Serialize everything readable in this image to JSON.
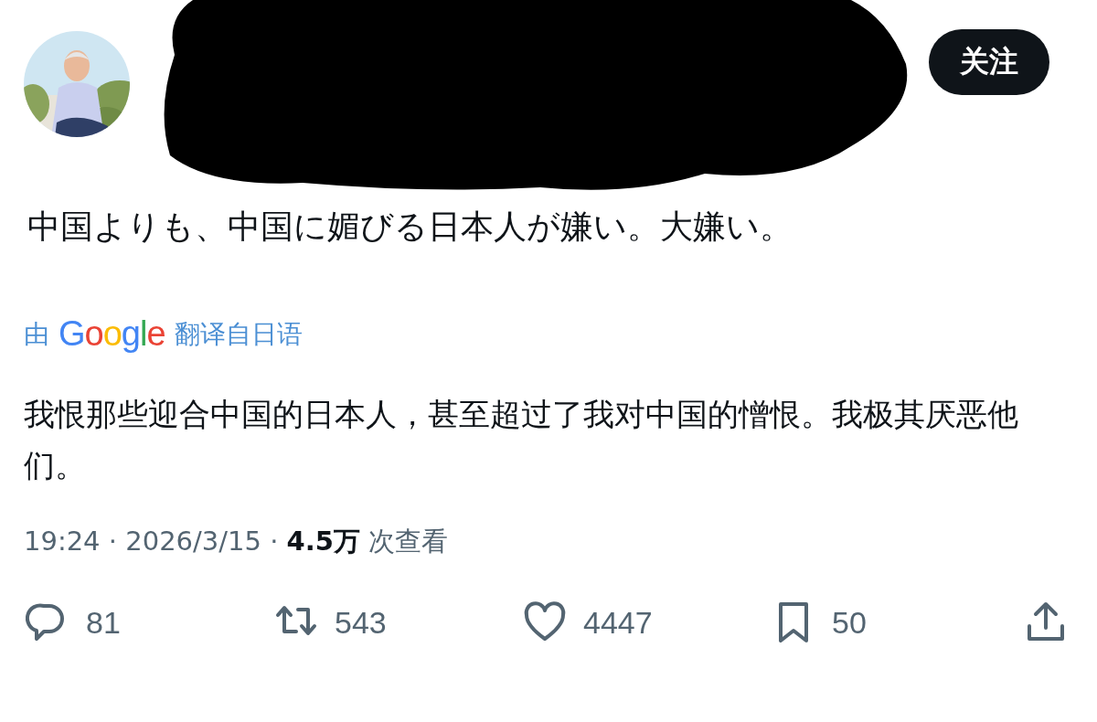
{
  "header": {
    "name_redacted": true,
    "follow_button": "关注"
  },
  "post_text": "中国よりも、中国に媚びる日本人が嫌い。大嫌い。",
  "translation": {
    "prefix": "由",
    "logo": "Google",
    "suffix": "翻译自日语",
    "text": "我恨那些迎合中国的日本人，甚至超过了我对中国的憎恨。我极其厌恶他们。"
  },
  "meta": "19:24 · 2026/3/15 · **4.5万** 次查看",
  "actions": [
    {
      "kind": "reply",
      "count": "81"
    },
    {
      "kind": "repost",
      "count": "543"
    },
    {
      "kind": "like",
      "count": "4447"
    },
    {
      "kind": "bookmark",
      "count": "50"
    },
    {
      "kind": "share"
    }
  ]
}
